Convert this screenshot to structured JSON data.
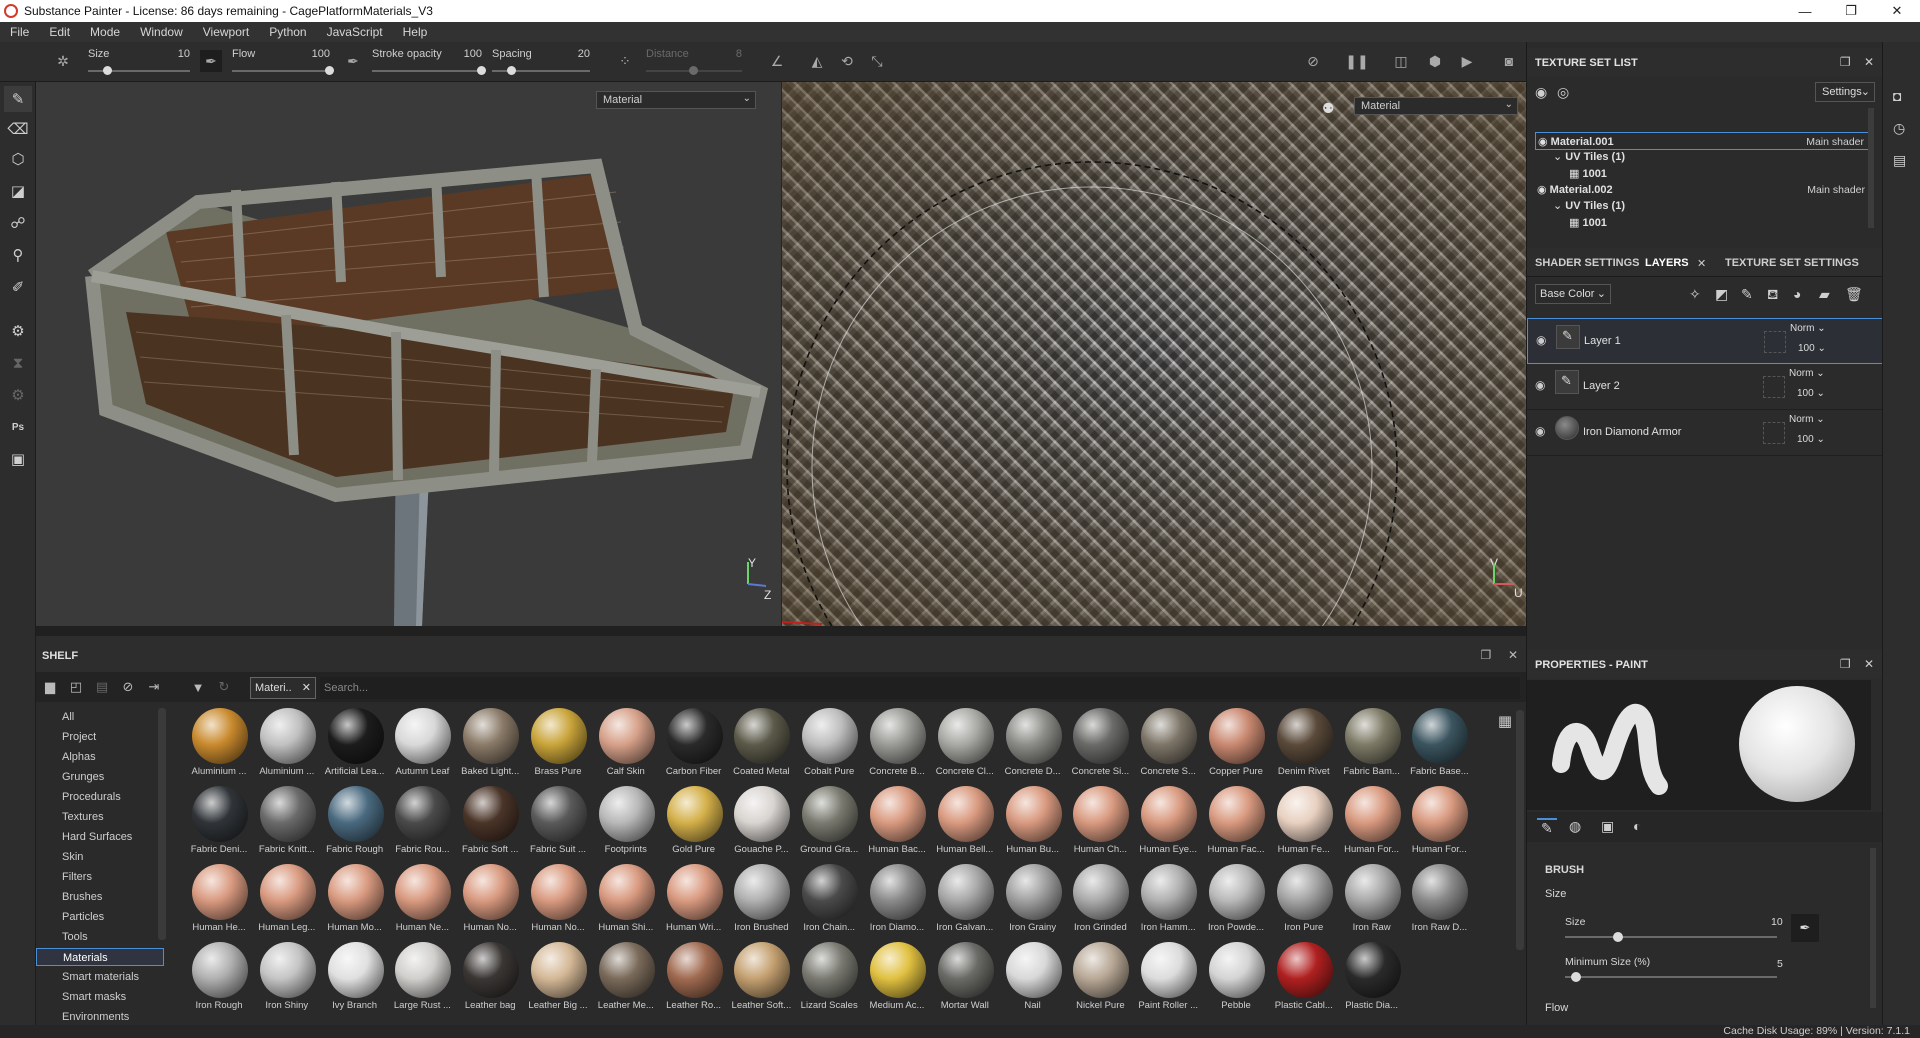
{
  "window": {
    "title": "Substance Painter - License: 86 days remaining - CagePlatformMaterials_V3",
    "controls": [
      "—",
      "❐",
      "✕"
    ]
  },
  "menu": [
    "File",
    "Edit",
    "Mode",
    "Window",
    "Viewport",
    "Python",
    "JavaScript",
    "Help"
  ],
  "toolbar": {
    "size": {
      "label": "Size",
      "value": "10",
      "level": 0.2
    },
    "flow": {
      "label": "Flow",
      "value": "100",
      "level": 1.0
    },
    "stroke_opacity": {
      "label": "Stroke opacity",
      "value": "100",
      "level": 1.0
    },
    "spacing": {
      "label": "Spacing",
      "value": "20",
      "level": 0.2
    },
    "distance": {
      "label": "Distance",
      "value": "8",
      "level": 0.5
    }
  },
  "viewport3d": {
    "mode": "Material",
    "axes": {
      "y": "Y",
      "z": "Z"
    }
  },
  "viewport2d": {
    "mode": "Material",
    "axes": {
      "v": "V",
      "u": "U"
    }
  },
  "shelf": {
    "title": "SHELF",
    "filter_chip": "Materi..",
    "search_placeholder": "Search...",
    "categories": [
      "All",
      "Project",
      "Alphas",
      "Grunges",
      "Procedurals",
      "Textures",
      "Hard Surfaces",
      "Skin",
      "Filters",
      "Brushes",
      "Particles",
      "Tools",
      "Materials",
      "Smart materials",
      "Smart masks",
      "Environments"
    ],
    "selected_category": "Materials",
    "materials": [
      {
        "name": "Aluminium ...",
        "color": "#c98a2e"
      },
      {
        "name": "Aluminium ...",
        "color": "#c0c0c0"
      },
      {
        "name": "Artificial Lea...",
        "color": "#1c1c1c"
      },
      {
        "name": "Autumn Leaf",
        "color": "#d8d8d8"
      },
      {
        "name": "Baked Light...",
        "color": "#8a7a68"
      },
      {
        "name": "Brass Pure",
        "color": "#c9a43a"
      },
      {
        "name": "Calf Skin",
        "color": "#d6a089"
      },
      {
        "name": "Carbon Fiber",
        "color": "#2a2a2a"
      },
      {
        "name": "Coated Metal",
        "color": "#5c5a4a"
      },
      {
        "name": "Cobalt Pure",
        "color": "#bdbdbd"
      },
      {
        "name": "Concrete B...",
        "color": "#9a9a96"
      },
      {
        "name": "Concrete Cl...",
        "color": "#a8a8a4"
      },
      {
        "name": "Concrete D...",
        "color": "#8c8c88"
      },
      {
        "name": "Concrete Si...",
        "color": "#6a6a68"
      },
      {
        "name": "Concrete S...",
        "color": "#7d7568"
      },
      {
        "name": "Copper Pure",
        "color": "#c98870"
      },
      {
        "name": "Denim Rivet",
        "color": "#5a4a3a"
      },
      {
        "name": "Fabric Bam...",
        "color": "#7d7a66"
      },
      {
        "name": "Fabric Base...",
        "color": "#3b5560"
      },
      {
        "name": "Fabric Deni...",
        "color": "#303438"
      },
      {
        "name": "Fabric Knitt...",
        "color": "#6a6a6a"
      },
      {
        "name": "Fabric Rough",
        "color": "#4a6a80"
      },
      {
        "name": "Fabric Rou...",
        "color": "#4a4a4a"
      },
      {
        "name": "Fabric Soft ...",
        "color": "#4a3428"
      },
      {
        "name": "Fabric Suit ...",
        "color": "#5a5a5a"
      },
      {
        "name": "Footprints",
        "color": "#b8b8b8"
      },
      {
        "name": "Gold Pure",
        "color": "#d4b04a"
      },
      {
        "name": "Gouache P...",
        "color": "#d8d4d0"
      },
      {
        "name": "Ground Gra...",
        "color": "#7a7a70"
      },
      {
        "name": "Human Bac...",
        "color": "#d99a80"
      },
      {
        "name": "Human Bell...",
        "color": "#d99a80"
      },
      {
        "name": "Human Bu...",
        "color": "#d99a80"
      },
      {
        "name": "Human Ch...",
        "color": "#d99a80"
      },
      {
        "name": "Human Eye...",
        "color": "#d99a80"
      },
      {
        "name": "Human Fac...",
        "color": "#d99a80"
      },
      {
        "name": "Human Fe...",
        "color": "#e8d0c0"
      },
      {
        "name": "Human For...",
        "color": "#d99a80"
      },
      {
        "name": "Human For...",
        "color": "#d99a80"
      },
      {
        "name": "Human He...",
        "color": "#d99a80"
      },
      {
        "name": "Human Leg...",
        "color": "#d99a80"
      },
      {
        "name": "Human Mo...",
        "color": "#d99a80"
      },
      {
        "name": "Human Ne...",
        "color": "#d99a80"
      },
      {
        "name": "Human No...",
        "color": "#d99a80"
      },
      {
        "name": "Human No...",
        "color": "#d99a80"
      },
      {
        "name": "Human Shi...",
        "color": "#d99a80"
      },
      {
        "name": "Human Wri...",
        "color": "#d99a80"
      },
      {
        "name": "Iron Brushed",
        "color": "#b0b0b0"
      },
      {
        "name": "Iron Chain...",
        "color": "#4a4a4a"
      },
      {
        "name": "Iron Diamo...",
        "color": "#8a8a8a"
      },
      {
        "name": "Iron Galvan...",
        "color": "#a8a8a8"
      },
      {
        "name": "Iron Grainy",
        "color": "#a0a0a0"
      },
      {
        "name": "Iron Grinded",
        "color": "#aaaaaa"
      },
      {
        "name": "Iron Hamm...",
        "color": "#b0b0b0"
      },
      {
        "name": "Iron Powde...",
        "color": "#b8b8b8"
      },
      {
        "name": "Iron Pure",
        "color": "#a4a4a4"
      },
      {
        "name": "Iron Raw",
        "color": "#a8a8a8"
      },
      {
        "name": "Iron Raw D...",
        "color": "#8a8a8a"
      },
      {
        "name": "Iron Rough",
        "color": "#b0b0b0"
      },
      {
        "name": "Iron Shiny",
        "color": "#c4c4c4"
      },
      {
        "name": "Ivy Branch",
        "color": "#e0e0e0"
      },
      {
        "name": "Large Rust ...",
        "color": "#d0cfcc"
      },
      {
        "name": "Leather bag",
        "color": "#3a3634"
      },
      {
        "name": "Leather Big ...",
        "color": "#d4b896"
      },
      {
        "name": "Leather Me...",
        "color": "#7a6a5a"
      },
      {
        "name": "Leather Ro...",
        "color": "#a06a50"
      },
      {
        "name": "Leather Soft...",
        "color": "#c4a070"
      },
      {
        "name": "Lizard Scales",
        "color": "#7a7a72"
      },
      {
        "name": "Medium Ac...",
        "color": "#e0c040"
      },
      {
        "name": "Mortar Wall",
        "color": "#6a6a66"
      },
      {
        "name": "Nail",
        "color": "#d8d8d8"
      },
      {
        "name": "Nickel Pure",
        "color": "#b8a896"
      },
      {
        "name": "Paint Roller ...",
        "color": "#dcdcdc"
      },
      {
        "name": "Pebble",
        "color": "#d4d4d4"
      },
      {
        "name": "Plastic Cabl...",
        "color": "#b02020"
      },
      {
        "name": "Plastic Dia...",
        "color": "#2a2a2a"
      }
    ]
  },
  "texture_set_list": {
    "title": "TEXTURE SET LIST",
    "settings_label": "Settings",
    "rows": [
      {
        "label": "Material.001",
        "right": "Main shader",
        "indent": 0,
        "selected": true
      },
      {
        "label": "UV Tiles (1)",
        "right": "",
        "indent": 1,
        "selected": false
      },
      {
        "label": "1001",
        "right": "",
        "indent": 2,
        "selected": false
      },
      {
        "label": "Material.002",
        "right": "Main shader",
        "indent": 0,
        "selected": false
      },
      {
        "label": "UV Tiles (1)",
        "right": "",
        "indent": 1,
        "selected": false
      },
      {
        "label": "1001",
        "right": "",
        "indent": 2,
        "selected": false
      }
    ]
  },
  "layer_tabs": {
    "shader_settings": "SHADER SETTINGS",
    "layers": "LAYERS",
    "texture_set_settings": "TEXTURE SET SETTINGS"
  },
  "layers": {
    "channel": "Base Color",
    "items": [
      {
        "name": "Layer 1",
        "blend": "Norm",
        "opacity": "100",
        "selected": true
      },
      {
        "name": "Layer 2",
        "blend": "Norm",
        "opacity": "100",
        "selected": false
      },
      {
        "name": "Iron Diamond Armor",
        "blend": "Norm",
        "opacity": "100",
        "selected": false
      }
    ]
  },
  "properties": {
    "title": "PROPERTIES - PAINT",
    "brush_heading": "BRUSH",
    "size_group": "Size",
    "size_label": "Size",
    "size_value": "10",
    "size_level": 0.25,
    "min_size_label": "Minimum Size (%)",
    "min_size_value": "5",
    "min_size_level": 0.05,
    "flow_label": "Flow"
  },
  "status": {
    "text": "Cache Disk Usage:   89%  |  Version: 7.1.1"
  },
  "colors": {
    "accent": "#4a90d9",
    "panel": "#2b2b2b",
    "viewport": "#3a3a3a"
  }
}
